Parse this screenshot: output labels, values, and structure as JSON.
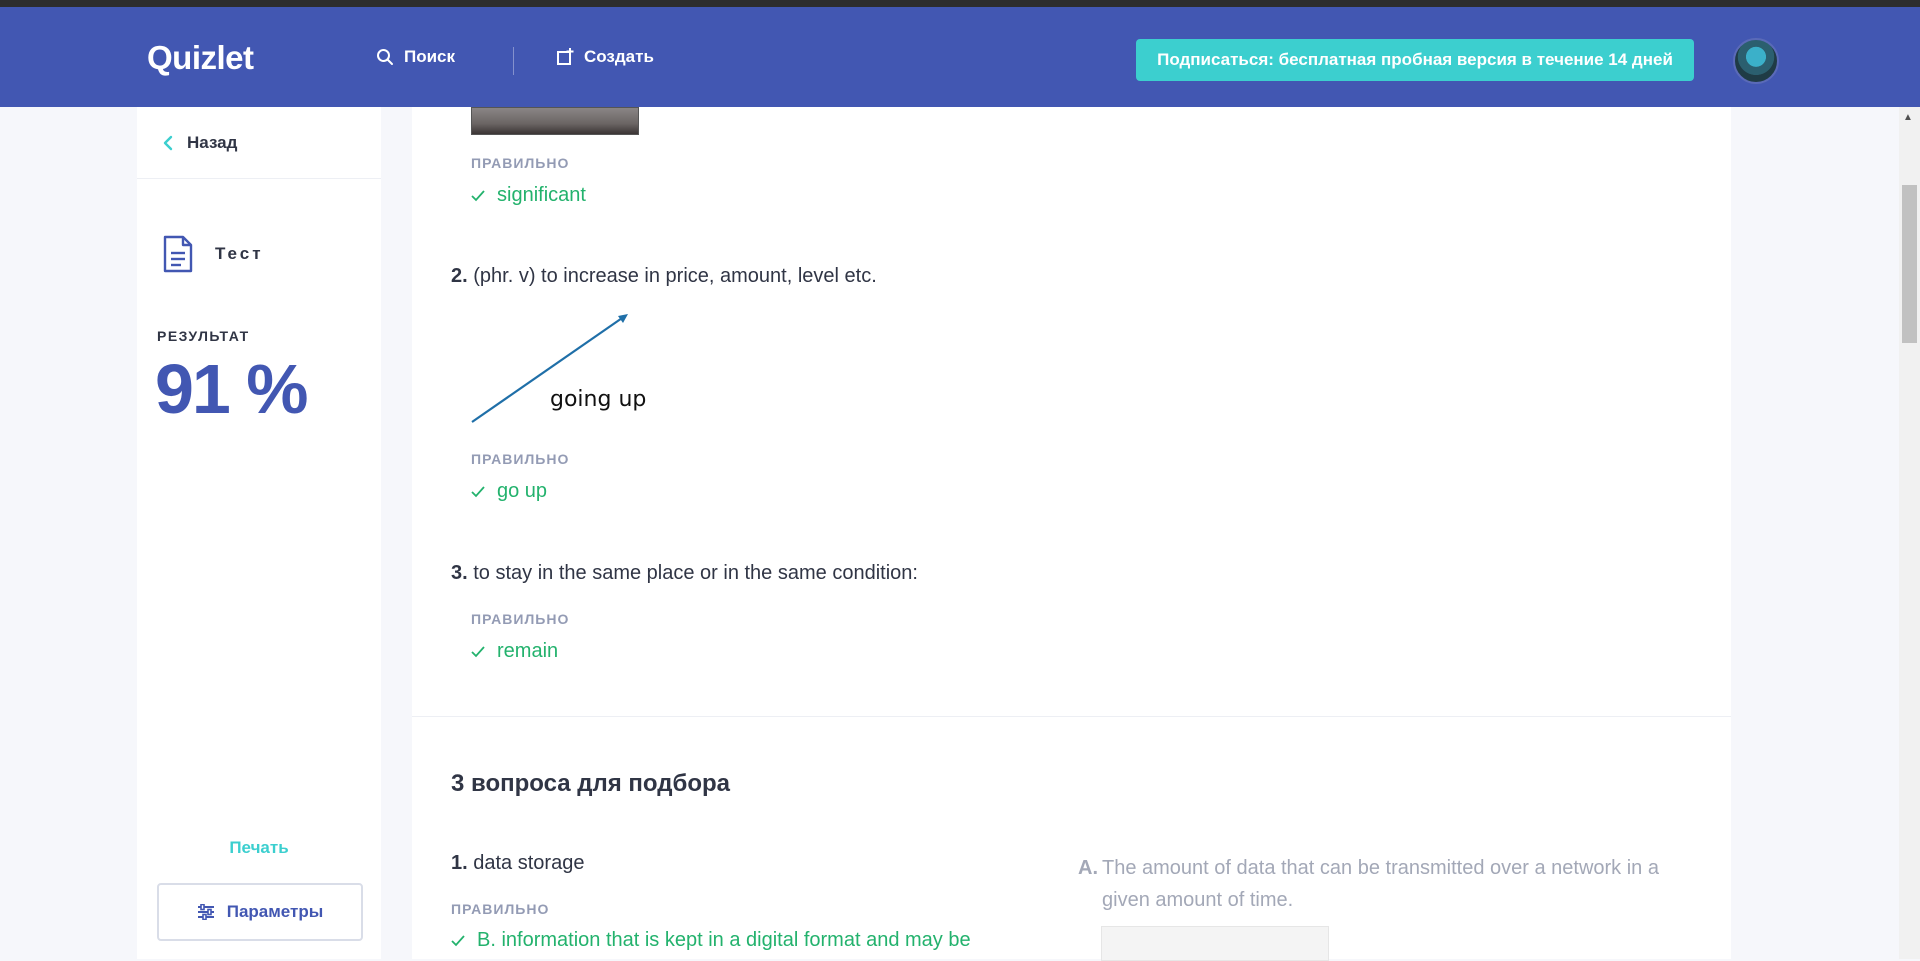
{
  "header": {
    "logo": "Quizlet",
    "search_label": "Поиск",
    "create_label": "Создать",
    "subscribe_label": "Подписаться: бесплатная пробная версия в течение 14 дней"
  },
  "sidebar": {
    "back_label": "Назад",
    "mode_label": "Тест",
    "result_label": "РЕЗУЛЬТАТ",
    "result_value": "91 %",
    "print_label": "Печать",
    "params_label": "Параметры"
  },
  "questions": [
    {
      "correct_label": "ПРАВИЛЬНО",
      "answer": "significant"
    },
    {
      "number": "2.",
      "prompt": "(phr. v) to increase in price, amount, level etc.",
      "image_caption": "going up",
      "correct_label": "ПРАВИЛЬНО",
      "answer": "go up"
    },
    {
      "number": "3.",
      "prompt": "to stay in the same place or in the same condition:",
      "correct_label": "ПРАВИЛЬНО",
      "answer": "remain"
    }
  ],
  "matching": {
    "heading": "3 вопроса для подбора",
    "q1_number": "1.",
    "q1_text": "data storage",
    "q1_correct_label": "ПРАВИЛЬНО",
    "q1_answer": "B. information that is kept in a digital format and may be",
    "option_a_letter": "A.",
    "option_a_text": "The amount of data that can be transmitted over a network in a given amount of time."
  },
  "colors": {
    "header": "#4257b2",
    "accent": "#3ccfcf",
    "correct": "#23b26d",
    "result": "#4257b2"
  }
}
